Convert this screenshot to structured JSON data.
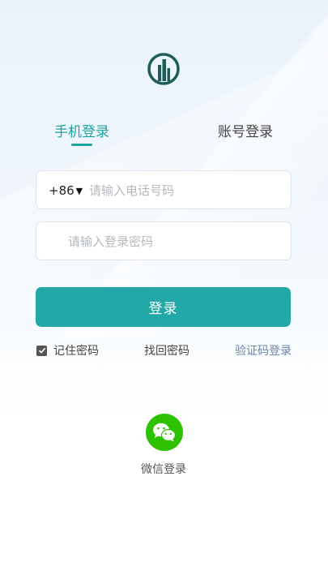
{
  "tabs": {
    "active": "手机登录",
    "inactive": "账号登录"
  },
  "phone_field": {
    "country_code": "+86",
    "placeholder": "请输入电话号码"
  },
  "password_field": {
    "placeholder": "请输入登录密码"
  },
  "login_button": "登录",
  "options": {
    "remember_label": "记住密码",
    "remember_checked": true,
    "forgot_label": "找回密码",
    "code_login_label": "验证码登录"
  },
  "social": {
    "wechat_label": "微信登录"
  },
  "icons": {
    "logo": "app-logo-icon",
    "wechat": "wechat-icon",
    "caret": "caret-down-icon",
    "checkbox": "checkbox-checked-icon"
  },
  "colors": {
    "accent": "#22a8a6",
    "tab_active": "#1fa3a0",
    "logo": "#1e5c55",
    "wechat": "#2dc100",
    "link": "#6d85a8"
  }
}
